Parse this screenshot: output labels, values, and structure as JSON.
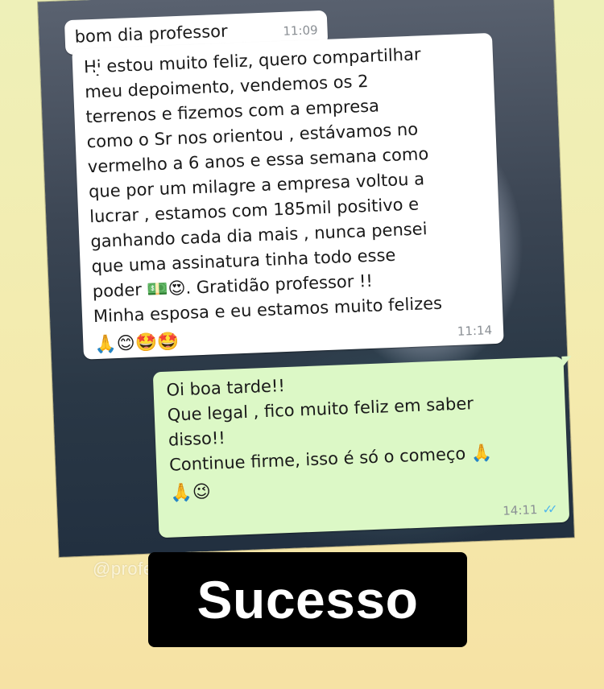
{
  "chat": {
    "messages": [
      {
        "direction": "incoming",
        "lines": [
          "bom dia professor"
        ],
        "time": "11:09"
      },
      {
        "direction": "incoming",
        "lines": [
          "Hj estou muito feliz, quero compartilhar",
          "meu depoimento,  vendemos os 2",
          "terrenos e fizemos com a empresa",
          "como o Sr nos orientou , estávamos no",
          "vermelho a 6 anos e essa semana como",
          "que por um milagre a empresa voltou a",
          "lucrar , estamos com 185mil positivo e",
          "ganhando cada dia mais , nunca pensei",
          "que uma assinatura tinha todo esse",
          "poder 💵😍. Gratidão professor !!",
          "Minha esposa e eu estamos muito felizes",
          "🙏😊🤩🤩"
        ],
        "time": "11:14"
      },
      {
        "direction": "outgoing",
        "lines": [
          "Oi boa tarde!!",
          "Que legal , fico muito feliz em saber",
          "disso!!",
          "Continue firme,  isso é só o começo 🙏",
          "🙏😉"
        ],
        "time": "14:11",
        "status_icon": "double-check-read-icon",
        "status_glyph": "✓✓"
      }
    ]
  },
  "watermark": "@profe",
  "banner": {
    "text": "Sucesso"
  },
  "colors": {
    "incoming_bubble": "#ffffff",
    "outgoing_bubble": "#dcf8c6",
    "read_ticks": "#4fb6ec",
    "banner_bg": "#000000"
  }
}
